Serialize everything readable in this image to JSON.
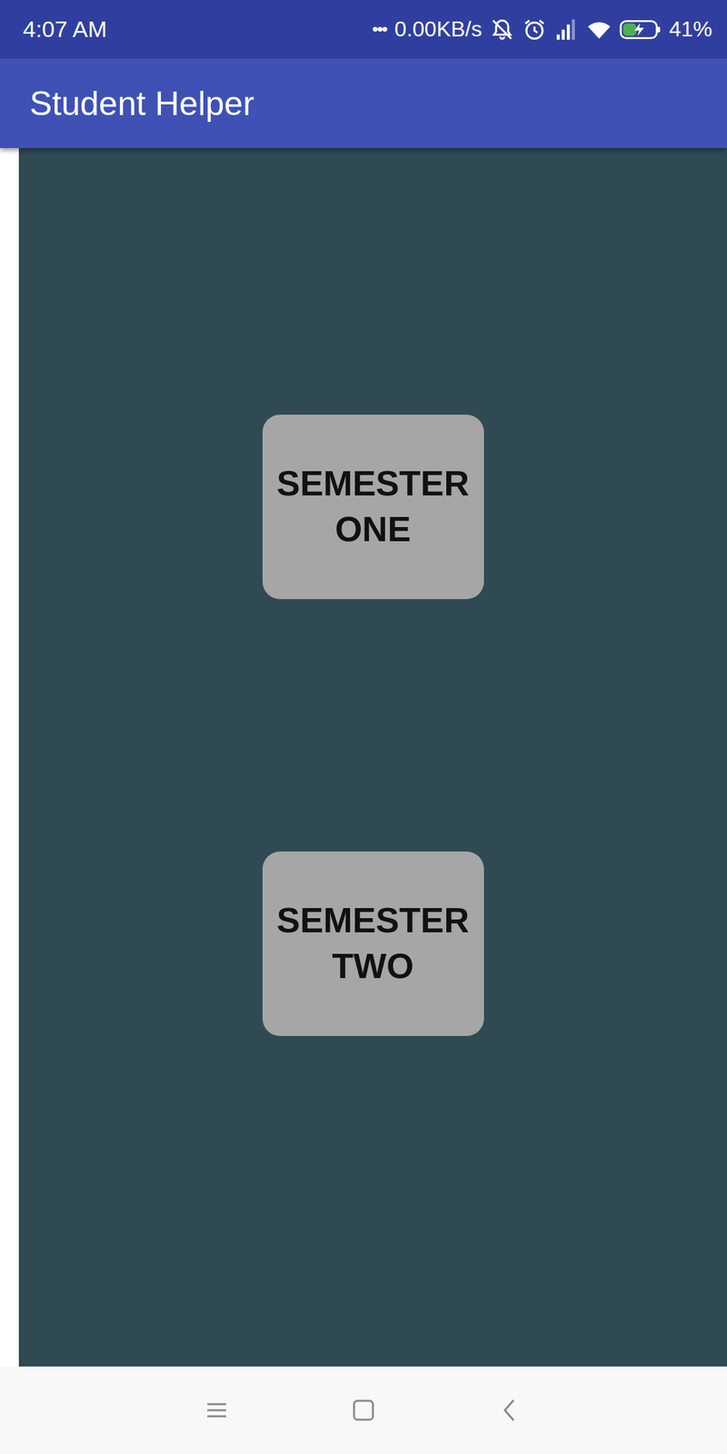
{
  "status_bar": {
    "time": "4:07 AM",
    "more": "•••",
    "speed": "0.00KB/s",
    "signal": {
      "level": 0.75
    },
    "battery": {
      "level": 0.41,
      "charging": true,
      "reading": "41%"
    }
  },
  "app_bar": {
    "title": "Student Helper"
  },
  "buttons": [
    {
      "label": "SEMESTER ONE"
    },
    {
      "label": "SEMESTER TWO"
    }
  ]
}
